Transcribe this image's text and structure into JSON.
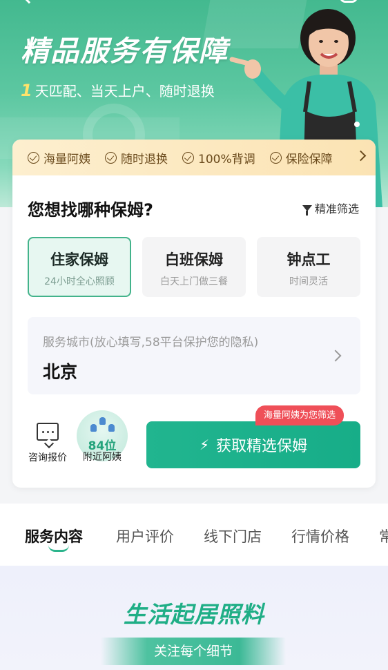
{
  "hero": {
    "title": "精品服务有保障",
    "subtitle_num": "1",
    "subtitle_rest": "天匹配、当天上户、随时退换"
  },
  "features": [
    "海量阿姨",
    "随时退换",
    "100%背调",
    "保险保障"
  ],
  "question": {
    "title": "您想找哪种保姆?",
    "filter_label": "精准筛选"
  },
  "options": [
    {
      "name": "住家保姆",
      "desc": "24小时全心照顾",
      "selected": true
    },
    {
      "name": "白班保姆",
      "desc": "白天上门做三餐",
      "selected": false
    },
    {
      "name": "钟点工",
      "desc": "时间灵活",
      "selected": false
    }
  ],
  "city": {
    "placeholder": "服务城市(放心填写,58平台保护您的隐私)",
    "value": "北京"
  },
  "consult": {
    "label": "咨询报价"
  },
  "nearby": {
    "count": "84位",
    "label": "附近阿姨"
  },
  "cta": {
    "label": "获取精选保姆",
    "badge": "海量阿姨为您筛选"
  },
  "tabs": [
    "服务内容",
    "用户评价",
    "线下门店",
    "行情价格",
    "常"
  ],
  "section": {
    "title": "生活起居照料",
    "subtitle": "关注每个细节"
  },
  "colors": {
    "accent": "#21b58f",
    "badge": "#ef4f58",
    "feature_bar": "#fbe3b3"
  }
}
